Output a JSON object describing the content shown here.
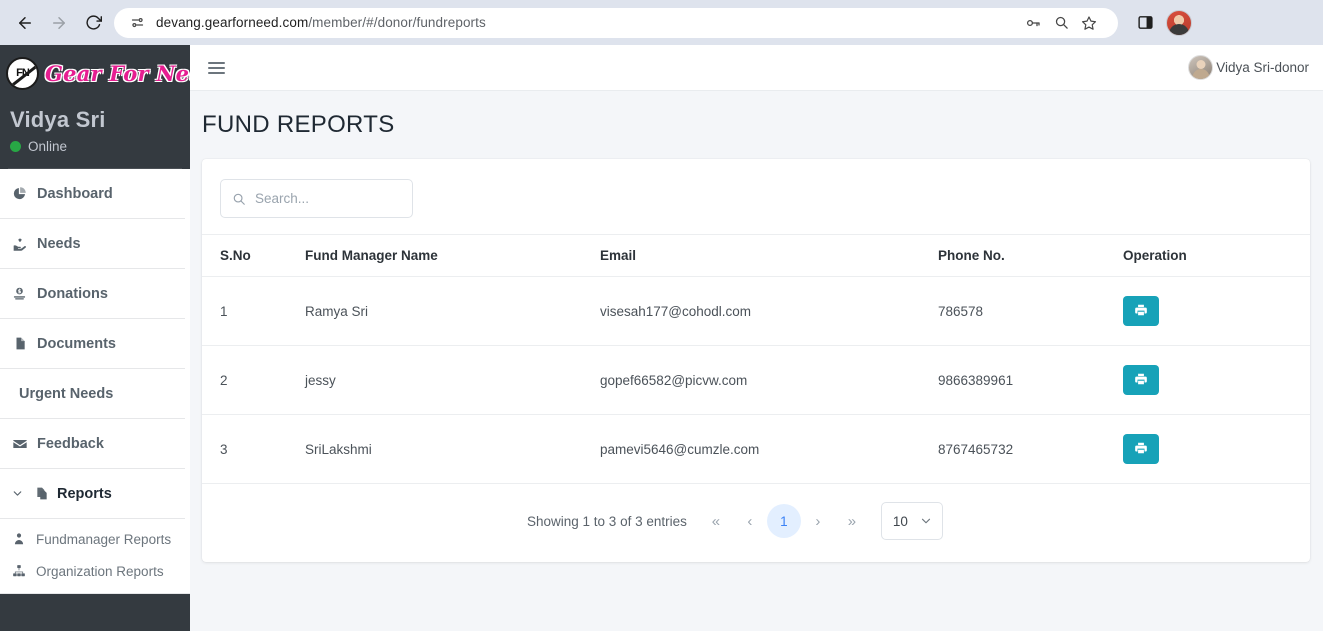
{
  "browser": {
    "url_host": "devang.gearforneed.com",
    "url_path": "/member/#/donor/fundreports",
    "back_icon": "back-arrow-icon",
    "forward_icon": "forward-arrow-icon",
    "reload_icon": "reload-icon",
    "site_info_icon": "site-settings-icon",
    "password_icon": "password-key-icon",
    "zoom_icon": "search-magnifier-icon",
    "bookmark_icon": "star-bookmark-icon",
    "side_panel_icon": "side-panel-icon",
    "profile_icon": "browser-profile-avatar"
  },
  "sidebar": {
    "brand_badge": "FN",
    "brand_name": "Gear For Need",
    "user_name": "Vidya Sri",
    "status_label": "Online",
    "items": [
      {
        "label": "Dashboard",
        "icon": "pie-chart-icon"
      },
      {
        "label": "Needs",
        "icon": "hand-heart-icon"
      },
      {
        "label": "Donations",
        "icon": "donate-icon"
      },
      {
        "label": "Documents",
        "icon": "file-icon"
      },
      {
        "label": "Urgent Needs",
        "icon": ""
      },
      {
        "label": "Feedback",
        "icon": "envelope-icon"
      }
    ],
    "reports": {
      "label": "Reports",
      "icon": "copy-files-icon",
      "chevron": "chevron-down-icon",
      "subitems": [
        {
          "label": "Fundmanager Reports",
          "icon": "user-tie-icon"
        },
        {
          "label": "Organization Reports",
          "icon": "sitemap-icon"
        }
      ]
    }
  },
  "topbar": {
    "menu_icon": "hamburger-menu-icon",
    "user_label": "Vidya Sri-donor",
    "avatar": "user-avatar"
  },
  "page": {
    "title": "FUND REPORTS"
  },
  "search": {
    "placeholder": "Search...",
    "value": "",
    "icon": "search-icon"
  },
  "table": {
    "columns": [
      "S.No",
      "Fund Manager Name",
      "Email",
      "Phone No.",
      "Operation"
    ],
    "rows": [
      {
        "sno": "1",
        "name": "Ramya Sri",
        "email": "visesah177@cohodl.com",
        "phone": "786578",
        "operation_icon": "print-icon"
      },
      {
        "sno": "2",
        "name": "jessy",
        "email": "gopef66582@picvw.com",
        "phone": "9866389961",
        "operation_icon": "print-icon"
      },
      {
        "sno": "3",
        "name": "SriLakshmi",
        "email": "pamevi5646@cumzle.com",
        "phone": "8767465732",
        "operation_icon": "print-icon"
      }
    ]
  },
  "pagination": {
    "showing_text": "Showing 1 to 3 of 3 entries",
    "first_label": "«",
    "prev_label": "‹",
    "current_page": "1",
    "next_label": "›",
    "last_label": "»",
    "page_size": "10",
    "chevron_icon": "chevron-down-icon"
  },
  "colors": {
    "sidebar_bg": "#343a40",
    "brand_pink": "#e61e91",
    "online_green": "#28a745",
    "print_teal": "#17a2b8",
    "page_bg": "#f4f6f9",
    "active_page_blue": "#e3efff"
  }
}
